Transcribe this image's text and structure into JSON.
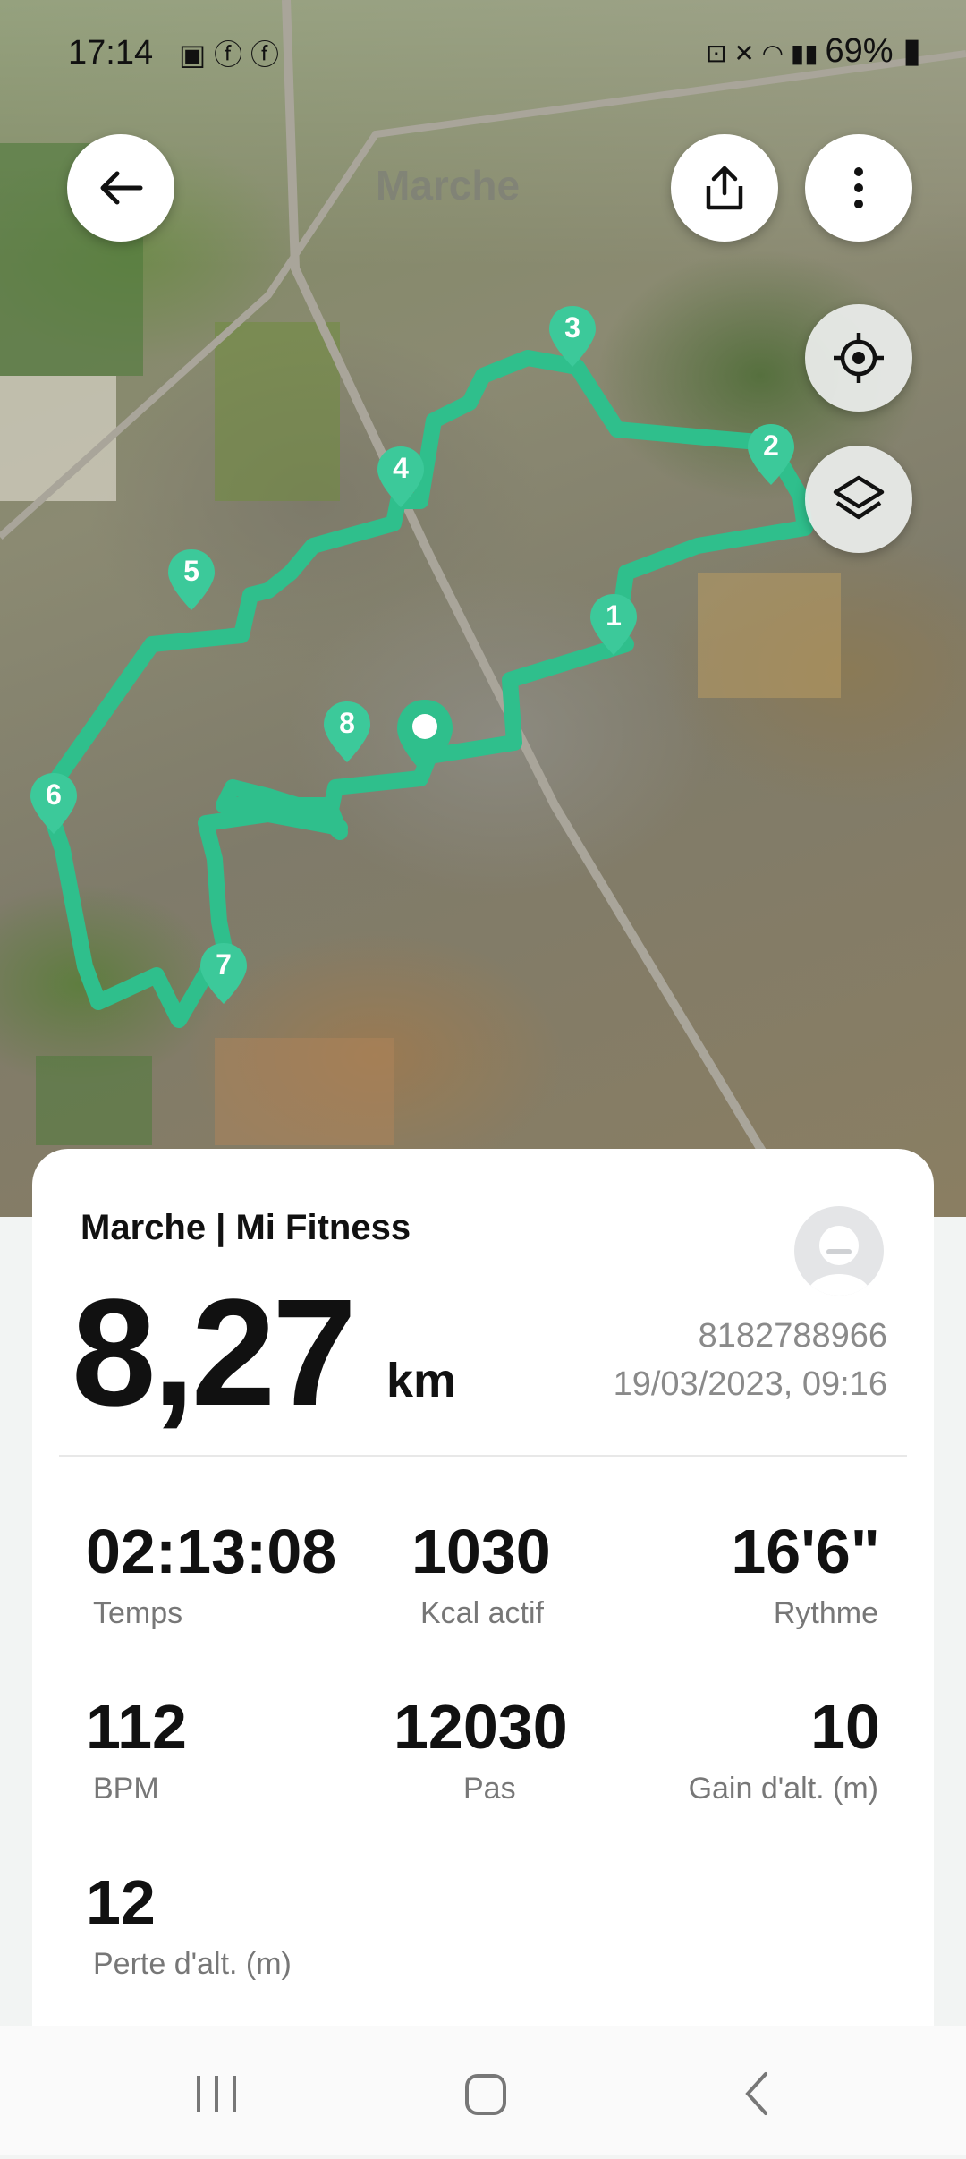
{
  "status_bar": {
    "time": "17:14",
    "battery": "69%"
  },
  "map": {
    "title": "Marche",
    "markers": [
      "1",
      "2",
      "3",
      "4",
      "5",
      "6",
      "7",
      "8"
    ]
  },
  "card": {
    "title": "Marche | Mi Fitness",
    "distance": "8,27",
    "unit": "km",
    "id": "8182788966",
    "datetime": "19/03/2023, 09:16"
  },
  "stats": [
    {
      "value": "02:13:08",
      "label": "Temps"
    },
    {
      "value": "1030",
      "label": "Kcal actif"
    },
    {
      "value": "16'6\"",
      "label": "Rythme"
    },
    {
      "value": "112",
      "label": "BPM"
    },
    {
      "value": "12030",
      "label": "Pas"
    },
    {
      "value": "10",
      "label": "Gain d'alt. (m)"
    },
    {
      "value": "12",
      "label": "Perte d'alt. (m)"
    }
  ],
  "colors": {
    "route": "#2fbf8c",
    "accent": "#3cc99a"
  },
  "icons": [
    "back-arrow-icon",
    "share-icon",
    "more-icon",
    "locate-icon",
    "layers-icon",
    "avatar-icon"
  ]
}
